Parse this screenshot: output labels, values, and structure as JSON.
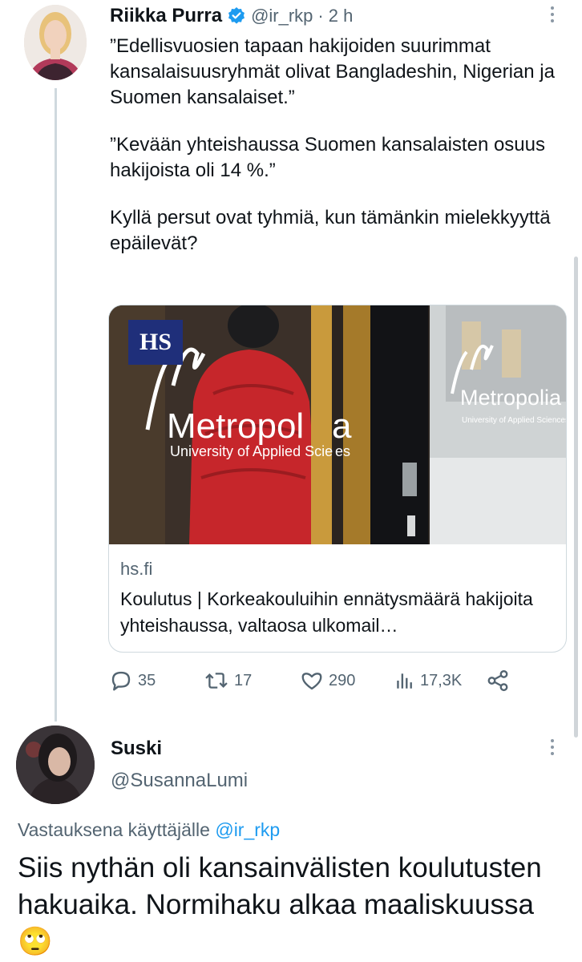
{
  "tweet": {
    "author_name": "Riikka Purra",
    "handle": "@ir_rkp",
    "separator": "·",
    "time": "2 h",
    "paragraphs": [
      "”Edellisvuosien tapaan hakijoiden suurimmat kansalaisuusryhmät olivat Bangladeshin, Nigerian ja Suomen kansalaiset.”",
      "”Kevään yhteishaussa Suomen kansalaisten osuus hakijoista oli 14 %.”",
      "Kyllä persut ovat tyhmiä, kun tämänkin mielekkyyttä epäilevät?"
    ],
    "card": {
      "badge": "HS",
      "sign_left_main": "Metropol",
      "sign_left_a": "a",
      "sign_left_sub": "University of Applied Scie",
      "sign_left_sub_end": "es",
      "sign_right_main": "Metropolia",
      "sign_right_sub": "University of Applied Sciences",
      "domain": "hs.fi",
      "title": "Koulutus | Korkeakouluihin ennätysmäärä hakijoita yhteishaussa, valtaosa ulkomail…"
    },
    "actions": {
      "replies": "35",
      "retweets": "17",
      "likes": "290",
      "views": "17,3K"
    }
  },
  "reply": {
    "author_name": "Suski",
    "handle": "@SusannaLumi",
    "replying_prefix": "Vastauksena käyttäjälle",
    "replying_to": "@ir_rkp",
    "text": "Siis nythän oli kansainvälisten koulutusten hakuaika. Normihaku alkaa maaliskuussa",
    "emoji": "🙄"
  },
  "colors": {
    "link": "#1d9bf0",
    "muted": "#536471",
    "verified": "#1d9bf0",
    "text": "#0f1419"
  },
  "icons": [
    "verified-badge-icon",
    "more-options-icon",
    "reply-icon",
    "retweet-icon",
    "like-icon",
    "views-icon",
    "share-icon"
  ]
}
